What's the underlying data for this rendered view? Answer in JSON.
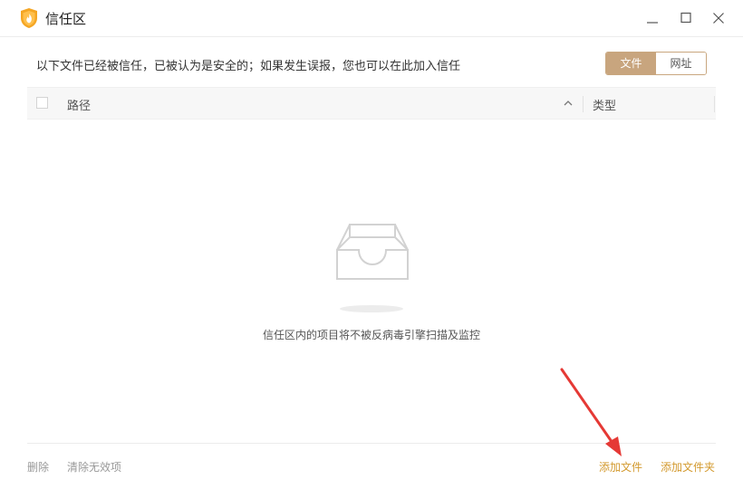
{
  "window": {
    "title": "信任区",
    "controls": [
      "minimize-icon",
      "maximize-icon",
      "close-icon"
    ]
  },
  "info": {
    "text": "以下文件已经被信任，已被认为是安全的；如果发生误报，您也可以在此加入信任"
  },
  "tabs": [
    {
      "label": "文件",
      "active": true
    },
    {
      "label": "网址",
      "active": false
    }
  ],
  "table": {
    "columns": {
      "path": "路径",
      "type": "类型"
    },
    "rows": []
  },
  "empty_state": {
    "icon": "empty-tray-icon",
    "message": "信任区内的项目将不被反病毒引擎扫描及监控"
  },
  "footer": {
    "delete": "删除",
    "clear_invalid": "清除无效项",
    "add_file": "添加文件",
    "add_folder": "添加文件夹"
  },
  "colors": {
    "accent": "#c8a57e",
    "link": "#d39a2f",
    "annotation_arrow": "#e53935"
  }
}
